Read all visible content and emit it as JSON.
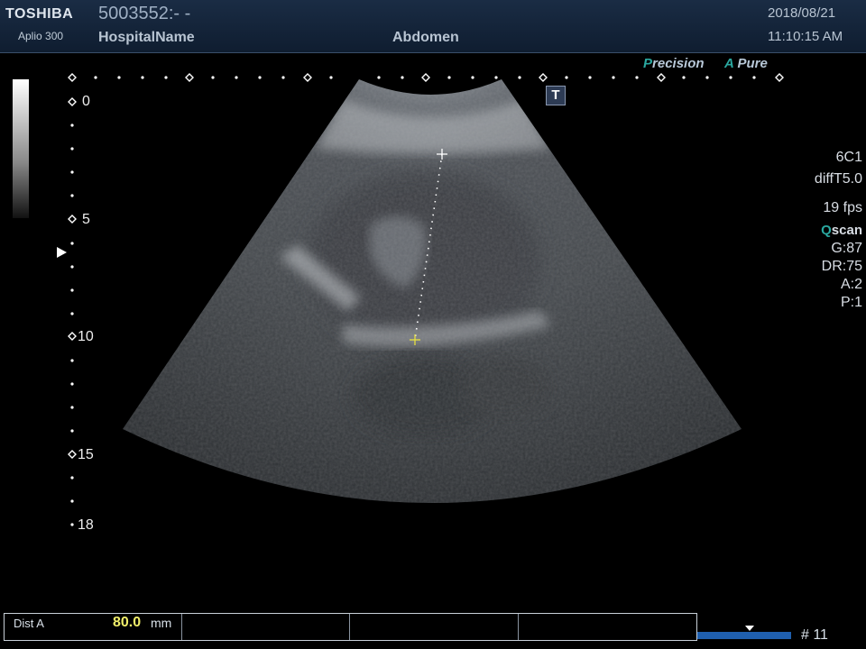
{
  "header": {
    "brand": "TOSHIBA",
    "model": "Aplio 300",
    "patient_id": "5003552:- -",
    "hospital": "HospitalName",
    "exam": "Abdomen",
    "date": "2018/08/21",
    "time": "11:10:15 AM"
  },
  "modes": {
    "precision_first": "P",
    "precision_rest": "recision",
    "apure_first": "A",
    "apure_rest": " Pure"
  },
  "depth_labels": [
    "0",
    "5",
    "10",
    "15",
    "18"
  ],
  "params": {
    "probe": "6C1",
    "preset": "diffT5.0",
    "fps": "19 fps",
    "qscan_q": "Q",
    "qscan_rest": "scan",
    "gain": "G:87",
    "dr": "DR:75",
    "a": "A:2",
    "p": "P:1"
  },
  "t_icon": "T",
  "measurement": {
    "label": "Dist A",
    "value": "80.0",
    "unit": "mm"
  },
  "frame": "# 11",
  "colors": {
    "header_bg": "#14243a",
    "measure_value": "#f1ef6a",
    "accent_teal": "#2aa8a0",
    "cine_bar": "#1f5fae"
  }
}
